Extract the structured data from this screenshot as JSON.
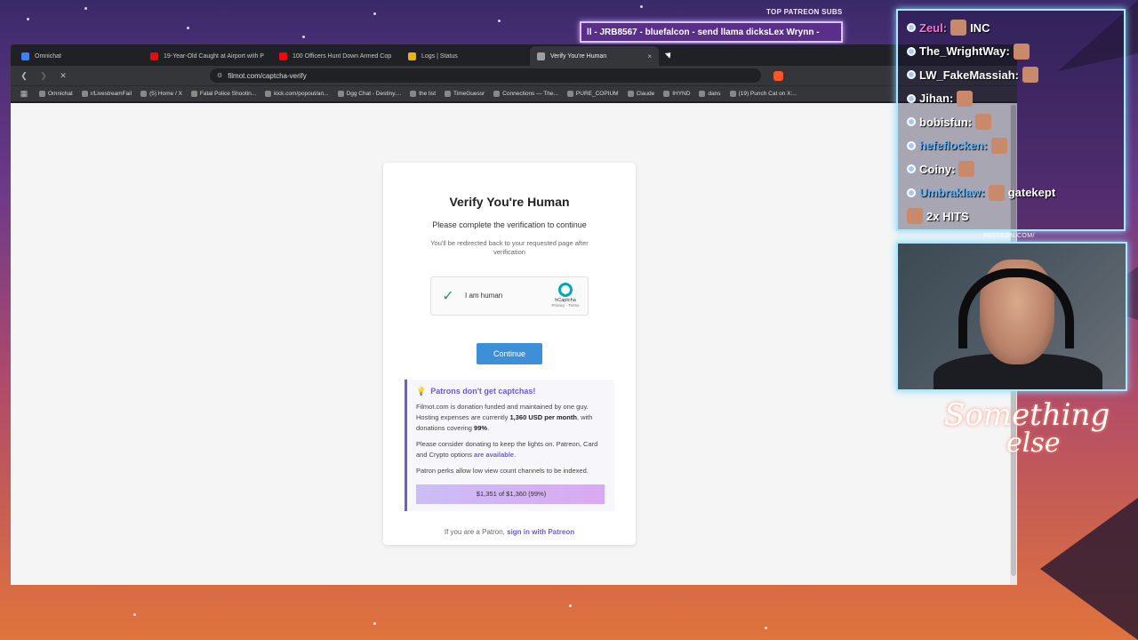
{
  "overlay": {
    "top_subs_label": "TOP PATREON SUBS",
    "ticker_text": "ll - JRB8567 - bluefalcon - send llama dicksLex Wrynn - ",
    "chat": [
      {
        "user": "Zeul:",
        "msg": "INC",
        "color": "#ff6fd8"
      },
      {
        "user": "The_WrightWay:",
        "msg": "",
        "color": "#ffffff"
      },
      {
        "user": "LW_FakeMassiah:",
        "msg": "",
        "color": "#ffffff"
      },
      {
        "user": "Jihan:",
        "msg": "",
        "color": "#ffffff"
      },
      {
        "user": "bobisfun:",
        "msg": "",
        "color": "#ffffff"
      },
      {
        "user": "hefeflocken:",
        "msg": "",
        "color": "#5fb8ff"
      },
      {
        "user": "Coiny:",
        "msg": "",
        "color": "#ffffff"
      },
      {
        "user": "Umbraklaw:",
        "msg": "gatekept",
        "color": "#5fb8ff"
      },
      {
        "user": "",
        "msg": "2x HITS",
        "color": "#ffffff"
      }
    ],
    "patreon_url": "PATREON.COM/",
    "signature_line1": "Something",
    "signature_line2": "else"
  },
  "browser": {
    "tabs": [
      {
        "title": "Omnichat",
        "fav_color": "#3b82f6",
        "active": false
      },
      {
        "title": "19-Year-Old Caught at Airport with P",
        "fav_color": "#ff0000",
        "active": false
      },
      {
        "title": "100 Officers Hunt Down Armed Cop",
        "fav_color": "#ff0000",
        "active": false
      },
      {
        "title": "Logs | Status",
        "fav_color": "#e6b800",
        "active": false
      },
      {
        "title": "Verify You're Human",
        "fav_color": "#9aa0a6",
        "active": true
      }
    ],
    "tab_close": "×",
    "new_tab": "+",
    "url": "filmot.com/captcha-verify",
    "bookmarks": [
      "Omnichat",
      "r/LivestreamFail",
      "(5) Home / X",
      "Fatal Police Shootin...",
      "kick.com/popout/an...",
      "Dgg Chat - Destiny....",
      "the list",
      "TimeGuessr",
      "Connections — The...",
      "PURE_COPIUM",
      "Claude",
      "IHYND",
      "dans",
      "(19) Punch Cat on X:..."
    ]
  },
  "page": {
    "title": "Verify You're Human",
    "subtitle": "Please complete the verification to continue",
    "note": "You'll be redirected back to your requested page after verification",
    "captcha": {
      "check": "✓",
      "label": "I am human",
      "brand": "hCaptcha",
      "terms": "Privacy - Terms"
    },
    "continue_label": "Continue",
    "patron": {
      "heading": "Patrons don't get captchas!",
      "p1_a": "Filmot.com is donation funded and maintained by one guy. Hosting expenses are currently ",
      "p1_b": "1,360 USD per month",
      "p1_c": ", with donations covering ",
      "p1_d": "99%",
      "p1_e": ".",
      "p2_a": "Please consider donating to keep the lights on. Patreon, Card and Crypto options ",
      "p2_link": "are available",
      "p2_b": ".",
      "p3": "Patron perks allow low view count channels to be indexed.",
      "progress_text": "$1,351 of $1,360 (99%)",
      "progress_fraction": 0.99
    },
    "signin_prefix": "If you are a Patron, ",
    "signin_link": "sign in with Patreon"
  }
}
